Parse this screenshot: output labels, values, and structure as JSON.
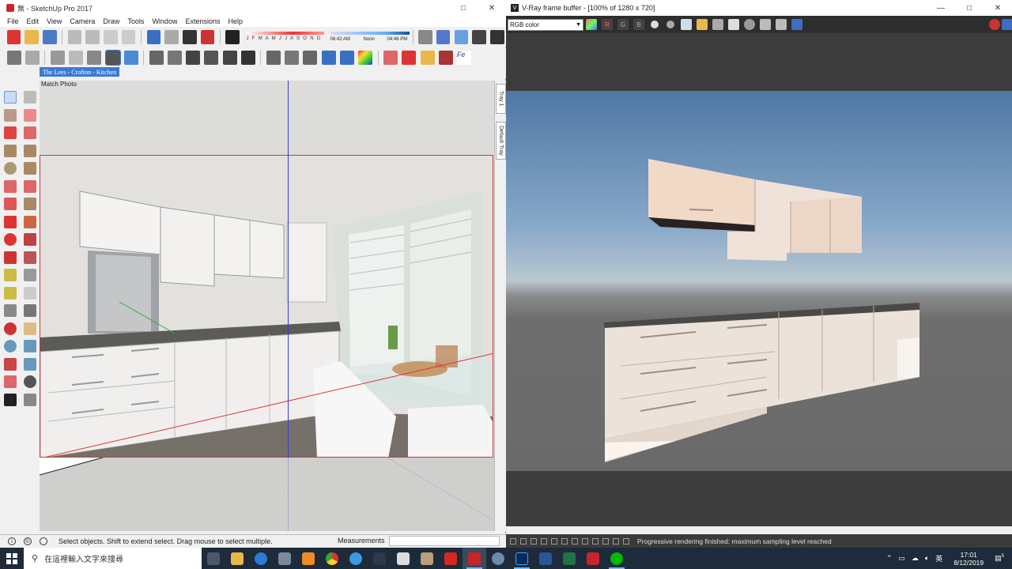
{
  "sketchup": {
    "title": "無 - SketchUp Pro 2017",
    "menu": [
      "File",
      "Edit",
      "View",
      "Camera",
      "Draw",
      "Tools",
      "Window",
      "Extensions",
      "Help"
    ],
    "shadow_months": "J F M A M J J A S O N D",
    "shadow_time_start": "06:42 AM",
    "shadow_time_mid": "Noon",
    "shadow_time_end": "04:46 PM",
    "scene_tab": "The Lees - Crofton - Kitchen",
    "viewport_label": "Match Photo",
    "tray_tabs": [
      "Tray 1",
      "Default Tray"
    ],
    "status_text": "Select objects. Shift to extend select. Drag mouse to select multiple.",
    "measurements_label": "Measurements",
    "measurements_value": ""
  },
  "vray": {
    "title": "V-Ray frame buffer - [100% of 1280 x 720]",
    "channel": "RGB color",
    "channel_buttons": [
      "R",
      "G",
      "B"
    ],
    "status_text": "Progressive rendering finished: maximum sampling level reached"
  },
  "taskbar": {
    "search_placeholder": "在這裡輸入文字來搜尋",
    "tray_lang": "英",
    "time": "17:01",
    "date": "8/12/2019",
    "notification_count": "5"
  },
  "colors": {
    "sketchup_accent": "#c8242b",
    "scene_tab": "#3a7ad6",
    "taskbar_bg": "#1d2b3a"
  }
}
